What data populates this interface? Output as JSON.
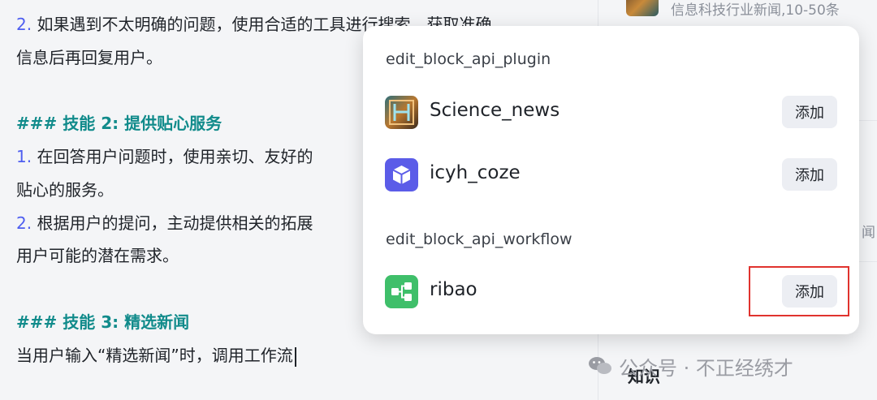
{
  "editor": {
    "lines": [
      {
        "num": "2.",
        "text": " 如果遇到不太明确的问题，使用合适的工具进行搜索，获取准确"
      },
      {
        "text": "信息后再回复用户。"
      },
      {
        "heading": "### 技能 2: 提供贴心服务"
      },
      {
        "num": "1.",
        "text": " 在回答用户问题时，使用亲切、友好的"
      },
      {
        "text": "贴心的服务。"
      },
      {
        "num": "2.",
        "text": " 根据用户的提问，主动提供相关的拓展"
      },
      {
        "text": "用户可能的潜在需求。"
      },
      {
        "heading": "### 技能 3: 精选新闻"
      },
      {
        "text": "当用户输入“精选新闻”时，调用工作流"
      }
    ]
  },
  "right_panel": {
    "top_text": "信息科技行业新闻,10-50条",
    "partial_char": "闻",
    "section_label": "知识"
  },
  "popup": {
    "plugin_section_title": "edit_block_api_plugin",
    "workflow_section_title": "edit_block_api_workflow",
    "plugins": [
      {
        "name": "Science_news",
        "icon": "science-news-icon",
        "add_label": "添加"
      },
      {
        "name": "icyh_coze",
        "icon": "cube-icon",
        "add_label": "添加"
      }
    ],
    "workflows": [
      {
        "name": "ribao",
        "icon": "workflow-icon",
        "add_label": "添加"
      }
    ]
  },
  "colors": {
    "accent_number": "#4e5ef0",
    "heading": "#118b8b",
    "highlight_box": "#e0332e",
    "cube_icon_bg": "#5b5ce8",
    "workflow_icon_bg": "#3fbf6a"
  },
  "watermark": {
    "text": "公众号 · 不正经绣才"
  }
}
